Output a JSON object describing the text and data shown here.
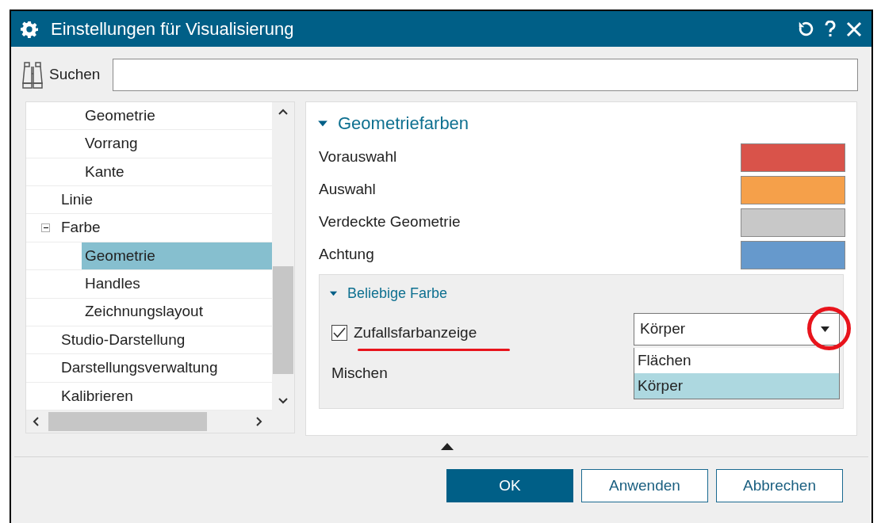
{
  "window": {
    "title": "Einstellungen für Visualisierung"
  },
  "search": {
    "label": "Suchen"
  },
  "tree": {
    "items": [
      {
        "children": [
          {
            "label": "Geometrie",
            "selected": false
          },
          {
            "label": "Vorrang",
            "selected": false
          },
          {
            "label": "Kante",
            "selected": false
          }
        ]
      },
      {
        "label": "Linie",
        "selected": false
      },
      {
        "label": "Farbe",
        "selected": false,
        "expanded": true,
        "children": [
          {
            "label": "Geometrie",
            "selected": true
          },
          {
            "label": "Handles",
            "selected": false
          },
          {
            "label": "Zeichnungslayout",
            "selected": false
          }
        ]
      },
      {
        "label": "Studio-Darstellung",
        "selected": false
      },
      {
        "label": "Darstellungsverwaltung",
        "selected": false
      },
      {
        "label": "Kalibrieren",
        "selected": false
      }
    ]
  },
  "section": {
    "title": "Geometriefarben",
    "expanded": true,
    "colors": [
      {
        "label": "Vorauswahl",
        "color": "#d9534a"
      },
      {
        "label": "Auswahl",
        "color": "#f5a04a"
      },
      {
        "label": "Verdeckte Geometrie",
        "color": "#c8c8c8"
      },
      {
        "label": "Achtung",
        "color": "#6699cc"
      }
    ],
    "subsection": {
      "title": "Beliebige Farbe",
      "expanded": true,
      "checkbox": {
        "label": "Zufallsfarbanzeige",
        "checked": true
      },
      "dropdown": {
        "value": "Körper",
        "open": true,
        "options": [
          {
            "label": "Flächen",
            "selected": false
          },
          {
            "label": "Körper",
            "selected": true
          }
        ]
      },
      "mix_label": "Mischen"
    }
  },
  "buttons": [
    {
      "label": "OK",
      "kind": "primary"
    },
    {
      "label": "Anwenden",
      "kind": "secondary"
    },
    {
      "label": "Abbrechen",
      "kind": "secondary"
    }
  ]
}
